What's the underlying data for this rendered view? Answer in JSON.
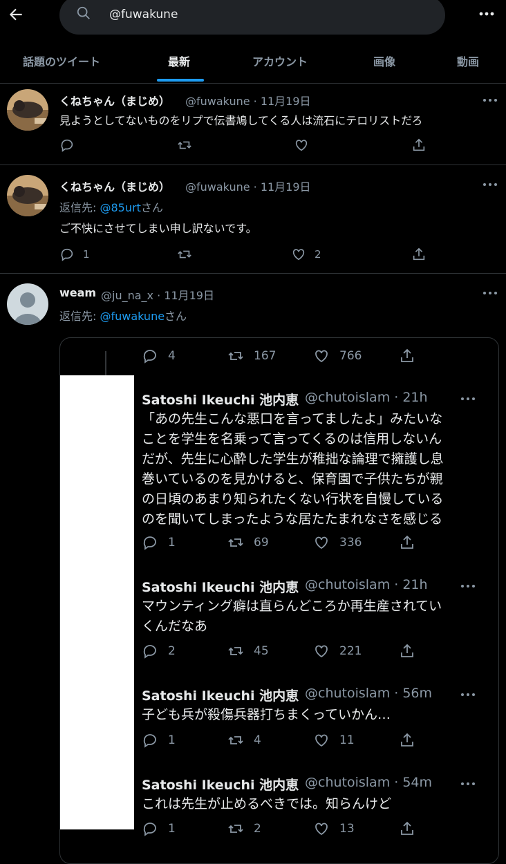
{
  "search": {
    "value": "@fuwakune"
  },
  "tabs": [
    "話題のツイート",
    "最新",
    "アカウント",
    "画像",
    "動画"
  ],
  "tweets": [
    {
      "name": "くねちゃん（まじめ）",
      "meta": "@fuwakune · 11月19日",
      "text": "見ようとしてないものをリプで伝書鳩してくる人は流石にテロリストだろ",
      "replies": "",
      "likes": ""
    },
    {
      "name": "くねちゃん（まじめ）",
      "meta": "@fuwakune · 11月19日",
      "reply_prefix": "返信先: ",
      "reply_mention": "@85urt",
      "reply_suffix": "さん",
      "text": "ご不快にさせてしまい申し訳ないです。",
      "replies": "1",
      "likes": "2"
    },
    {
      "name": "weam",
      "meta": "@ju_na_x · 11月19日",
      "reply_prefix": "返信先: ",
      "reply_mention": "@fuwakune",
      "reply_suffix": "さん"
    }
  ],
  "quote": {
    "top_stats": {
      "replies": "4",
      "retweets": "167",
      "likes": "766"
    },
    "items": [
      {
        "name": "Satoshi Ikeuchi 池内恵",
        "meta": "@chutoislam · 21h",
        "lines": [
          "「あの先生こんな悪口を言ってましたよ」みたいな",
          "ことを学生を名乗って言ってくるのは信用しないん",
          "だが、先生に心酔した学生が稚拙な論理で擁護し息",
          "巻いているのを見かけると、保育園で子供たちが親",
          "の日頃のあまり知られたくない行状を自慢している",
          "のを聞いてしまったような居たたまれなさを感じる"
        ],
        "replies": "1",
        "retweets": "69",
        "likes": "336"
      },
      {
        "name": "Satoshi Ikeuchi 池内恵",
        "meta": "@chutoislam · 21h",
        "lines": [
          "マウンティング癖は直らんどころか再生産されてい",
          "くんだなあ"
        ],
        "replies": "2",
        "retweets": "45",
        "likes": "221"
      },
      {
        "name": "Satoshi Ikeuchi 池内恵",
        "meta": "@chutoislam · 56m",
        "lines": [
          "子ども兵が殺傷兵器打ちまくっていかん…"
        ],
        "replies": "1",
        "retweets": "4",
        "likes": "11"
      },
      {
        "name": "Satoshi Ikeuchi 池内恵",
        "meta": "@chutoislam · 54m",
        "lines": [
          "これは先生が止めるべきでは。知らんけど"
        ],
        "replies": "1",
        "retweets": "2",
        "likes": "13"
      }
    ]
  },
  "colors": {
    "accent": "#1d9bf0",
    "muted": "#8b98a5",
    "border": "#2f3336"
  },
  "icons": [
    "back-arrow-icon",
    "search-icon",
    "more-icon",
    "reply-icon",
    "retweet-icon",
    "like-icon",
    "share-icon",
    "default-avatar-icon"
  ]
}
